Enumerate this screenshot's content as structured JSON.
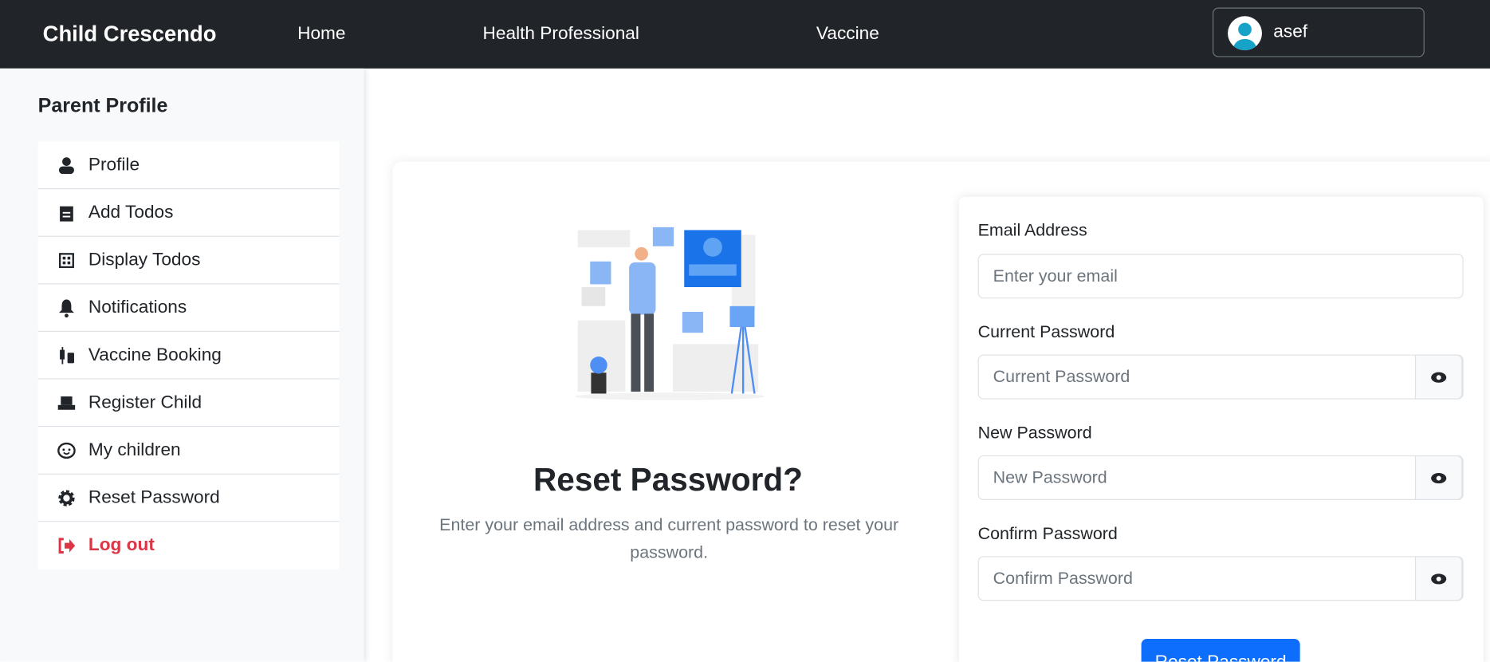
{
  "navbar": {
    "brand": "Child Crescendo",
    "links": [
      "Home",
      "Health Professional",
      "Vaccine"
    ],
    "user": "asef"
  },
  "sidebar": {
    "title": "Parent Profile",
    "items": [
      {
        "label": "Profile",
        "icon": "user-icon"
      },
      {
        "label": "Add Todos",
        "icon": "clipboard-icon"
      },
      {
        "label": "Display Todos",
        "icon": "grid-icon"
      },
      {
        "label": "Notifications",
        "icon": "bell-icon"
      },
      {
        "label": "Vaccine Booking",
        "icon": "syringe-icon"
      },
      {
        "label": "Register Child",
        "icon": "cash-register-icon"
      },
      {
        "label": "My children",
        "icon": "baby-face-icon"
      },
      {
        "label": "Reset Password",
        "icon": "gear-icon"
      },
      {
        "label": "Log out",
        "icon": "sign-out-icon"
      }
    ]
  },
  "main": {
    "title": "Reset Password?",
    "subtitle": "Enter your email address and current password to reset your password.",
    "form": {
      "email_label": "Email Address",
      "email_placeholder": "Enter your email",
      "current_label": "Current Password",
      "current_placeholder": "Current Password",
      "new_label": "New Password",
      "new_placeholder": "New Password",
      "confirm_label": "Confirm Password",
      "confirm_placeholder": "Confirm Password",
      "submit": "Reset Password"
    }
  },
  "colors": {
    "navbar": "#212529",
    "primary": "#0d6efd",
    "danger": "#dc3545"
  }
}
